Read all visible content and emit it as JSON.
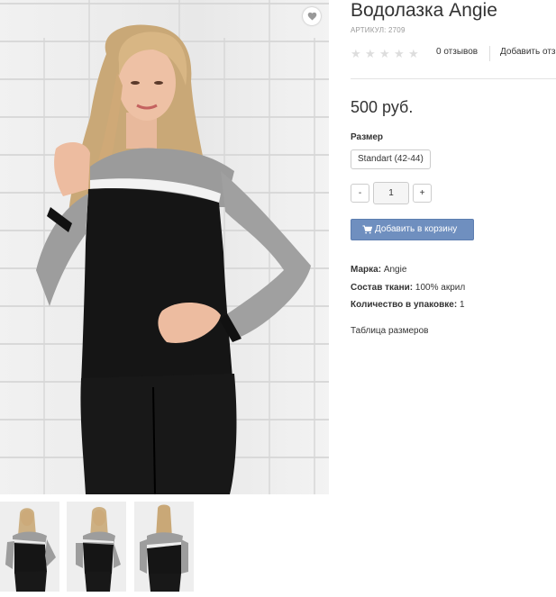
{
  "product": {
    "title": "Водолазка Angie",
    "sku": "АРТИКУЛ: 2709",
    "rating": 0,
    "reviews_label": "0 отзывов",
    "compare_label": "Добавить отз",
    "price": "500 руб.",
    "size_label": "Размер",
    "size_option": "Standart (42-44)",
    "quantity": "1",
    "qty_minus": "-",
    "qty_plus": "+",
    "add_to_cart": "Добавить в корзину",
    "properties": [
      {
        "name": "Марка:",
        "value": "Angie"
      },
      {
        "name": "Состав ткани:",
        "value": "100% акрил"
      },
      {
        "name": "Количество в упаковке:",
        "value": "1"
      }
    ],
    "size_table_link": "Таблица размеров"
  },
  "icons": {
    "favorite": "heart-icon",
    "cart": "cart-icon",
    "star": "star-icon"
  },
  "colors": {
    "accent": "#6f8fbf",
    "star_empty": "#dddddd",
    "sweater_black": "#111111",
    "sweater_gray": "#9a9a9a"
  }
}
